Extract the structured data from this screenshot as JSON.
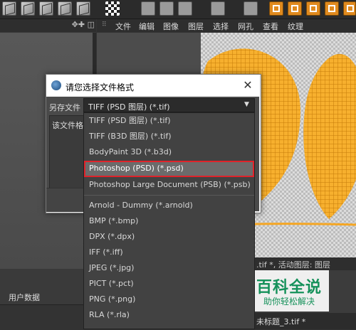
{
  "menubar": {
    "items": [
      "文件",
      "编辑",
      "图像",
      "图层",
      "选择",
      "网孔",
      "查看",
      "纹理"
    ]
  },
  "left_panel": {
    "nav_icons": "✥✚ ◫",
    "user_data_label": "用户数据"
  },
  "status": {
    "text": ".tif *, 活动图层: 图层",
    "file_tab": "未标题_3.tif *"
  },
  "watermark": {
    "title": "百科全说",
    "subtitle": "助你轻松解决"
  },
  "dialog": {
    "title": "请您选择文件格式",
    "close": "✕",
    "save_as_label": "另存文件",
    "description_label": "该文件格",
    "selected_value": "TIFF (PSD 图层) (*.tif)",
    "select_arrow": "▼",
    "options_top": [
      "TIFF (PSD 图层) (*.tif)",
      "TIFF (B3D 图层) (*.tif)",
      "BodyPaint 3D (*.b3d)",
      "Photoshop (PSD) (*.psd)",
      "Photoshop Large Document (PSB) (*.psb)"
    ],
    "options_bottom": [
      "Arnold - Dummy (*.arnold)",
      "BMP (*.bmp)",
      "DPX (*.dpx)",
      "IFF (*.iff)",
      "JPEG (*.jpg)",
      "PICT (*.pct)",
      "PNG (*.png)",
      "RLA (*.rla)"
    ],
    "highlighted_option": "Photoshop (PSD) (*.psd)"
  },
  "colors": {
    "highlight_border": "#e0232a",
    "texture_wire": "#f5a623",
    "watermark_green": "#15915a"
  }
}
